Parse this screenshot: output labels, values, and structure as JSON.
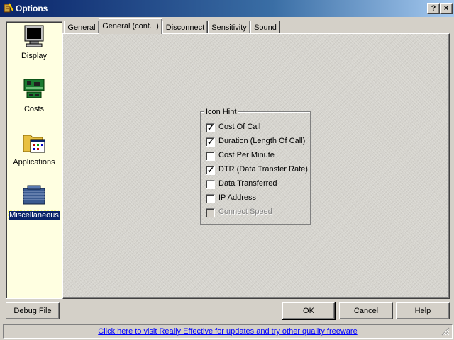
{
  "window": {
    "title": "Options",
    "help_button": "?",
    "close_button": "×"
  },
  "categories": [
    {
      "label": "Display",
      "icon": "monitor-icon",
      "selected": false
    },
    {
      "label": "Costs",
      "icon": "circuit-board-icon",
      "selected": false
    },
    {
      "label": "Applications",
      "icon": "folder-icon",
      "selected": false
    },
    {
      "label": "Miscellaneous",
      "icon": "miscellaneous-icon",
      "selected": true
    }
  ],
  "tabs": [
    {
      "label": "General",
      "active": false
    },
    {
      "label": "General (cont...)",
      "active": true
    },
    {
      "label": "Disconnect",
      "active": false
    },
    {
      "label": "Sensitivity",
      "active": false
    },
    {
      "label": "Sound",
      "active": false
    }
  ],
  "icon_hint": {
    "legend": "Icon Hint",
    "options": [
      {
        "label": "Cost Of Call",
        "checked": true,
        "enabled": true
      },
      {
        "label": "Duration (Length Of Call)",
        "checked": true,
        "enabled": true
      },
      {
        "label": "Cost Per Minute",
        "checked": false,
        "enabled": true
      },
      {
        "label": "DTR (Data Transfer Rate)",
        "checked": true,
        "enabled": true
      },
      {
        "label": "Data Transferred",
        "checked": false,
        "enabled": true
      },
      {
        "label": "IP Address",
        "checked": false,
        "enabled": true
      },
      {
        "label": "Connect Speed",
        "checked": false,
        "enabled": false
      }
    ]
  },
  "buttons": {
    "debug_file": "Debug File",
    "ok": "OK",
    "cancel": "Cancel",
    "help": "Help"
  },
  "status": {
    "link_text": "Click here to visit Really Effective for updates and try other quality freeware"
  },
  "colors": {
    "titlebar": "#0a246a",
    "category_panel": "#ffffe1",
    "link": "#0000ff"
  }
}
